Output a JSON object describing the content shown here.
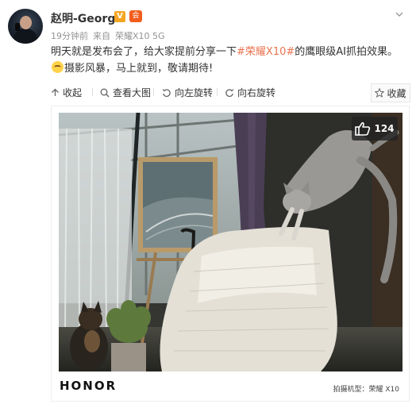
{
  "user": {
    "name": "赵明-George",
    "verified_badge": "V",
    "member_badge": "会"
  },
  "meta": {
    "time": "19分钟前",
    "source_prefix": "来自",
    "source_device": "荣耀X10 5G"
  },
  "post": {
    "text_before": "明天就是发布会了，给大家提前分享一下",
    "hashtag": "#荣耀X10#",
    "text_after": "的鹰眼级AI抓拍效果。",
    "text_end": "摄影风暴，马上就到，敬请期待!",
    "emoji": "grin-emoji"
  },
  "toolbar": {
    "collapse": "收起",
    "view_large": "查看大图",
    "rotate_left": "向左旋转",
    "rotate_right": "向右旋转",
    "favorite": "收藏"
  },
  "image": {
    "like_count": "124",
    "brand": "HONOR",
    "shot_by": "拍摄机型：荣耀 X10"
  },
  "colors": {
    "hashtag": "#eb7350",
    "verified": "#f6a623",
    "member": "#f25c1d"
  }
}
